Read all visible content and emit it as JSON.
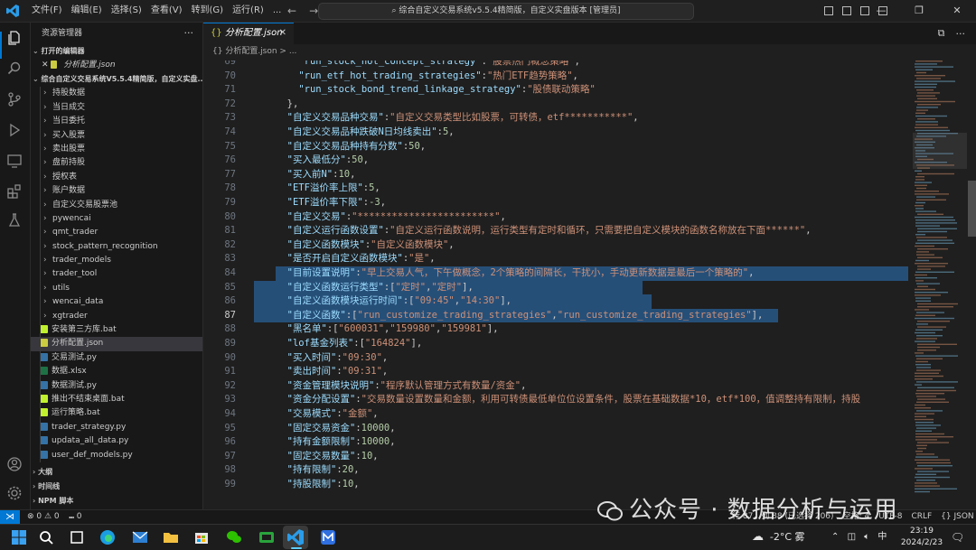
{
  "app": {
    "menu": [
      "文件(F)",
      "编辑(E)",
      "选择(S)",
      "查看(V)",
      "转到(G)",
      "运行(R)",
      "..."
    ],
    "command_center": "综合自定义交易系统v5.5.4精简版，自定义实盘版本 [管理员]",
    "window_controls": [
      "—",
      "❐",
      "✕"
    ]
  },
  "sidebar": {
    "title": "资源管理器",
    "open_editors_header": "打开的编辑器",
    "open_editor_item": "分析配置.json",
    "project_header": "综合自定义交易系统V5.5.4精简版，自定义实盘...",
    "items": [
      {
        "label": "持股数据",
        "kind": "folder"
      },
      {
        "label": "当日成交",
        "kind": "folder"
      },
      {
        "label": "当日委托",
        "kind": "folder"
      },
      {
        "label": "买入股票",
        "kind": "folder"
      },
      {
        "label": "卖出股票",
        "kind": "folder"
      },
      {
        "label": "盘前持股",
        "kind": "folder"
      },
      {
        "label": "授权表",
        "kind": "folder"
      },
      {
        "label": "账户数据",
        "kind": "folder"
      },
      {
        "label": "自定义交易股票池",
        "kind": "folder"
      },
      {
        "label": "pywencai",
        "kind": "folder"
      },
      {
        "label": "qmt_trader",
        "kind": "folder"
      },
      {
        "label": "stock_pattern_recognition",
        "kind": "folder"
      },
      {
        "label": "trader_models",
        "kind": "folder"
      },
      {
        "label": "trader_tool",
        "kind": "folder"
      },
      {
        "label": "utils",
        "kind": "folder"
      },
      {
        "label": "wencai_data",
        "kind": "folder"
      },
      {
        "label": "xgtrader",
        "kind": "folder"
      },
      {
        "label": "安装第三方库.bat",
        "kind": "bat"
      },
      {
        "label": "分析配置.json",
        "kind": "json"
      },
      {
        "label": "交易测试.py",
        "kind": "py"
      },
      {
        "label": "数据.xlsx",
        "kind": "xlsx"
      },
      {
        "label": "数据测试.py",
        "kind": "py"
      },
      {
        "label": "推出不结束桌面.bat",
        "kind": "bat"
      },
      {
        "label": "运行策略.bat",
        "kind": "bat"
      },
      {
        "label": "trader_strategy.py",
        "kind": "py"
      },
      {
        "label": "updata_all_data.py",
        "kind": "py"
      },
      {
        "label": "user_def_models.py",
        "kind": "py"
      }
    ],
    "bottom_sections": [
      "大纲",
      "时间线",
      "NPM 脚本"
    ]
  },
  "editor": {
    "tab_label": "分析配置.json",
    "breadcrumb": "{} 分析配置.json > ...",
    "lines": [
      {
        "n": "69",
        "text": "    \"run_stock_hot_concept_strategy\":\"股票热门概念策略\","
      },
      {
        "n": "70",
        "text": "    \"run_etf_hot_trading_strategies\":\"热门ETF趋势策略\","
      },
      {
        "n": "71",
        "text": "    \"run_stock_bond_trend_linkage_strategy\":\"股债联动策略\""
      },
      {
        "n": "72",
        "text": "  },"
      },
      {
        "n": "73",
        "text": "  \"自定义交易品种交易\":\"自定义交易类型比如股票，可转债，etf***********\","
      },
      {
        "n": "74",
        "text": "  \"自定义交易品种跌破N日均线卖出\":5,"
      },
      {
        "n": "75",
        "text": "  \"自定义交易品种持有分数\":50,"
      },
      {
        "n": "76",
        "text": "  \"买入最低分\":50,"
      },
      {
        "n": "77",
        "text": "  \"买入前N\":10,"
      },
      {
        "n": "78",
        "text": "  \"ETF溢价率上限\":5,"
      },
      {
        "n": "79",
        "text": "  \"ETF溢价率下限\":-3,"
      },
      {
        "n": "80",
        "text": "  \"自定义交易\":\"************************\","
      },
      {
        "n": "81",
        "text": "  \"自定义运行函数设置\":\"自定义运行函数说明，运行类型有定时和循环，只需要把自定义模块的函数名称放在下面******\","
      },
      {
        "n": "82",
        "text": "  \"自定义函数模块\":\"自定义函数模块\","
      },
      {
        "n": "83",
        "text": "  \"是否开启自定义函数模块\":\"是\","
      },
      {
        "n": "84",
        "text": "  \"目前设置说明\":\"早上交易人气，下午做概念，2个策略的间隔长，干扰小，手动更新数据是最后一个策略的\","
      },
      {
        "n": "85",
        "text": "  \"自定义函数运行类型\":[\"定时\",\"定时\"],"
      },
      {
        "n": "86",
        "text": "  \"自定义函数模块运行时间\":[\"09:45\",\"14:30\"],"
      },
      {
        "n": "87",
        "text": "  \"自定义函数\":[\"run_customize_trading_strategies\",\"run_customize_trading_strategies\"],"
      },
      {
        "n": "88",
        "text": "  \"黑名单\":[\"600031\",\"159980\",\"159981\"],"
      },
      {
        "n": "89",
        "text": "  \"lof基金列表\":[\"164824\"],"
      },
      {
        "n": "90",
        "text": "  \"买入时间\":\"09:30\","
      },
      {
        "n": "91",
        "text": "  \"卖出时间\":\"09:31\","
      },
      {
        "n": "92",
        "text": "  \"资金管理模块说明\":\"程序默认管理方式有数量/资金\","
      },
      {
        "n": "93",
        "text": "  \"资金分配设置\":\"交易数量设置数量和金额，利用可转债最低单位位设置条件，股票在基础数据*10，etf*100，值调整持有限制，持股"
      },
      {
        "n": "94",
        "text": "  \"交易模式\":\"金额\","
      },
      {
        "n": "95",
        "text": "  \"固定交易资金\":10000,"
      },
      {
        "n": "96",
        "text": "  \"持有金额限制\":10000,"
      },
      {
        "n": "97",
        "text": "  \"固定交易数量\":10,"
      },
      {
        "n": "98",
        "text": "  \"持有限制\":20,"
      },
      {
        "n": "99",
        "text": "  \"持股限制\":10,"
      }
    ]
  },
  "statusbar": {
    "errors": "⊗ 0 ⚠ 0",
    "ports": "⑉ 0",
    "right_items": [
      "行 87，列 88 (已选择 206)",
      "空格: 4",
      "UTF-8",
      "CRLF",
      "{} JSON"
    ]
  },
  "watermark": "公众号 · 数据分析与运用",
  "taskbar": {
    "weather": "-2°C 雾",
    "ime": "中",
    "time": "23:19",
    "date": "2024/2/23"
  },
  "colors": {
    "key": "#9cdcfe",
    "string": "#ce9178",
    "number": "#b5cea8",
    "accent": "#0078d4",
    "selection": "#264f78"
  }
}
